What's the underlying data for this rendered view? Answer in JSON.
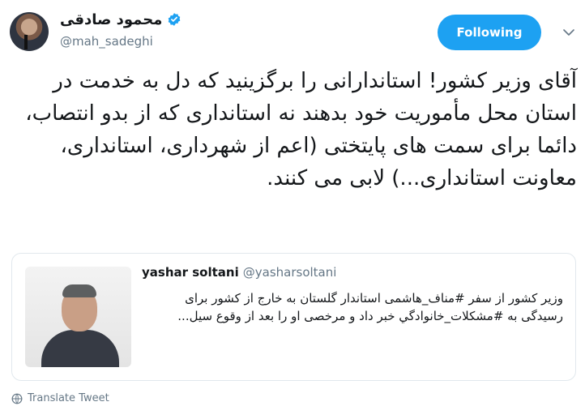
{
  "author": {
    "display_name": "محمود صادقی",
    "handle": "@mah_sadeghi"
  },
  "follow_button_label": "Following",
  "tweet_text": "آقای وزیر کشور! استاندارانی را برگزینید که دل به خدمت در استان محل مأموریت خود بدهند نه استانداری که از بدو انتصاب، دائما برای سمت های پایتختی (اعم از شهرداری، استانداری، معاونت استانداری...) لابی می کنند.",
  "quoted_tweet": {
    "display_name": "yashar soltani",
    "handle": "@yasharsoltani",
    "text": "وزیر کشور از سفر #مناف_هاشمی استاندار گلستان به خارج از کشور برای رسیدگی به #مشکلات_خانوادگي خبر داد و مرخصی او را بعد از وقوع سیل..."
  },
  "translate_label": "Translate Tweet",
  "colors": {
    "accent": "#1da1f2",
    "secondary_text": "#657786",
    "border": "#e1e8ed"
  }
}
